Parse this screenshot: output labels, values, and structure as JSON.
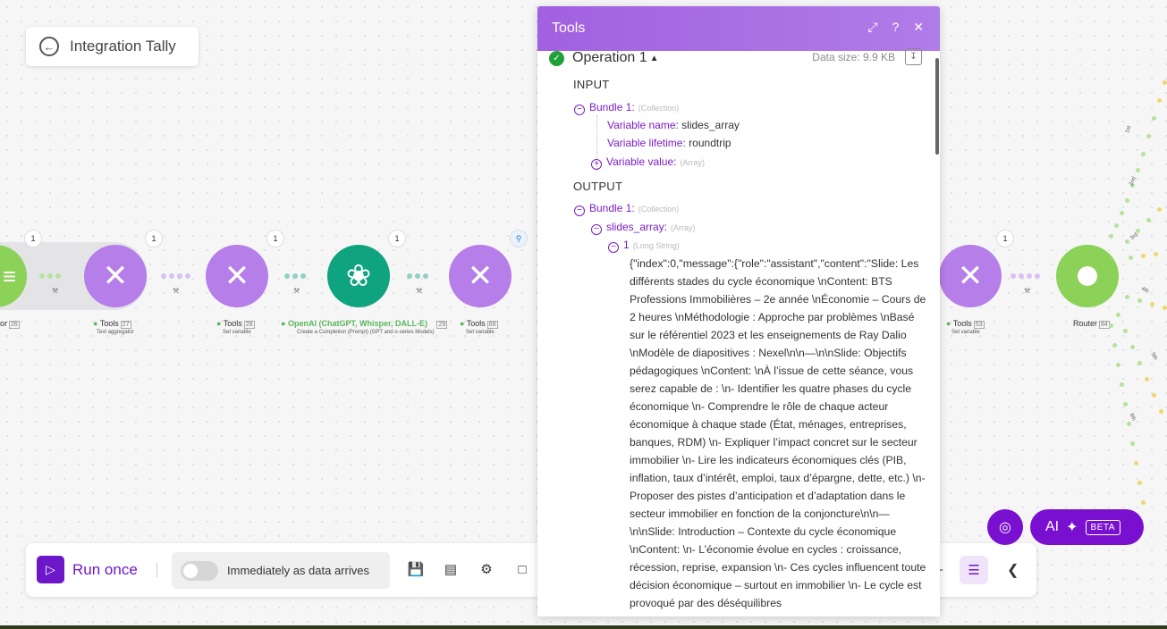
{
  "back_button": {
    "label": "Integration Tally"
  },
  "nodes": [
    {
      "title": "or",
      "num": "26",
      "sub": ""
    },
    {
      "title": "Tools",
      "num": "27",
      "sub": "Text aggregator",
      "badge": "1"
    },
    {
      "title": "Tools",
      "num": "28",
      "sub": "Set variable",
      "badge": "1"
    },
    {
      "title": "OpenAI (ChatGPT, Whisper, DALL-E)",
      "num": "29",
      "sub": "Create a Completion (Prompt) (GPT and o-series Models)",
      "badge": "1"
    },
    {
      "title": "Tools",
      "num": "68",
      "sub": "Set variable",
      "badge": "1"
    },
    {
      "title": "Tools",
      "num": "53",
      "sub": "Set variable",
      "badge": "1"
    },
    {
      "title": "Router",
      "num": "84",
      "sub": ""
    }
  ],
  "first_badge": "1",
  "route_labels": [
    "1st",
    "2nd",
    "3rd",
    "4th",
    "5th",
    "6th"
  ],
  "toolbar": {
    "run_label": "Run once",
    "schedule_label": "Immediately as data arrives"
  },
  "ai": {
    "label": "AI",
    "beta": "BETA"
  },
  "panel": {
    "title": "Tools",
    "operation": "Operation 1",
    "data_size": "Data size: 9.9 KB",
    "input_label": "INPUT",
    "output_label": "OUTPUT",
    "input_bundle": "Bundle 1:",
    "input_bundle_type": "(Collection)",
    "var_name_key": "Variable name:",
    "var_name_val": "slides_array",
    "var_life_key": "Variable lifetime:",
    "var_life_val": "roundtrip",
    "var_value_key": "Variable value:",
    "var_value_type": "(Array)",
    "output_bundle": "Bundle 1:",
    "output_bundle_type": "(Collection)",
    "slides_key": "slides_array:",
    "slides_type": "(Array)",
    "item_key": "1",
    "item_type": "(Long String)",
    "long_text": "{\"index\":0,\"message\":{\"role\":\"assistant\",\"content\":\"Slide: Les différents stades du cycle économique  \\nContent: BTS Professions Immobilières – 2e année  \\nÉconomie – Cours de 2 heures  \\nMéthodologie : Approche par problèmes \\nBasé sur le référentiel 2023 et les enseignements de Ray Dalio  \\nModèle de diapositives : Nexel\\n\\n—\\n\\nSlide: Objectifs pédagogiques  \\nContent:  \\nÀ l’issue de cette séance, vous serez capable de :  \\n- Identifier les quatre phases du cycle économique  \\n- Comprendre le rôle de chaque acteur économique à chaque stade (État, ménages, entreprises, banques, RDM)  \\n- Expliquer l’impact concret sur le secteur immobilier  \\n- Lire les indicateurs économiques clés (PIB, inflation, taux d’intérêt, emploi, taux d’épargne, dette, etc.)  \\n- Proposer des pistes d’anticipation et d’adaptation dans le secteur immobilier en fonction de la conjoncture\\n\\n—\\n\\nSlide: Introduction – Contexte du cycle économique  \\nContent:  \\n- L’économie évolue en cycles : croissance, récession, reprise, expansion  \\n- Ces cycles influencent toute décision économique – surtout en immobilier  \\n- Le cycle est provoqué par des déséquilibres"
  }
}
